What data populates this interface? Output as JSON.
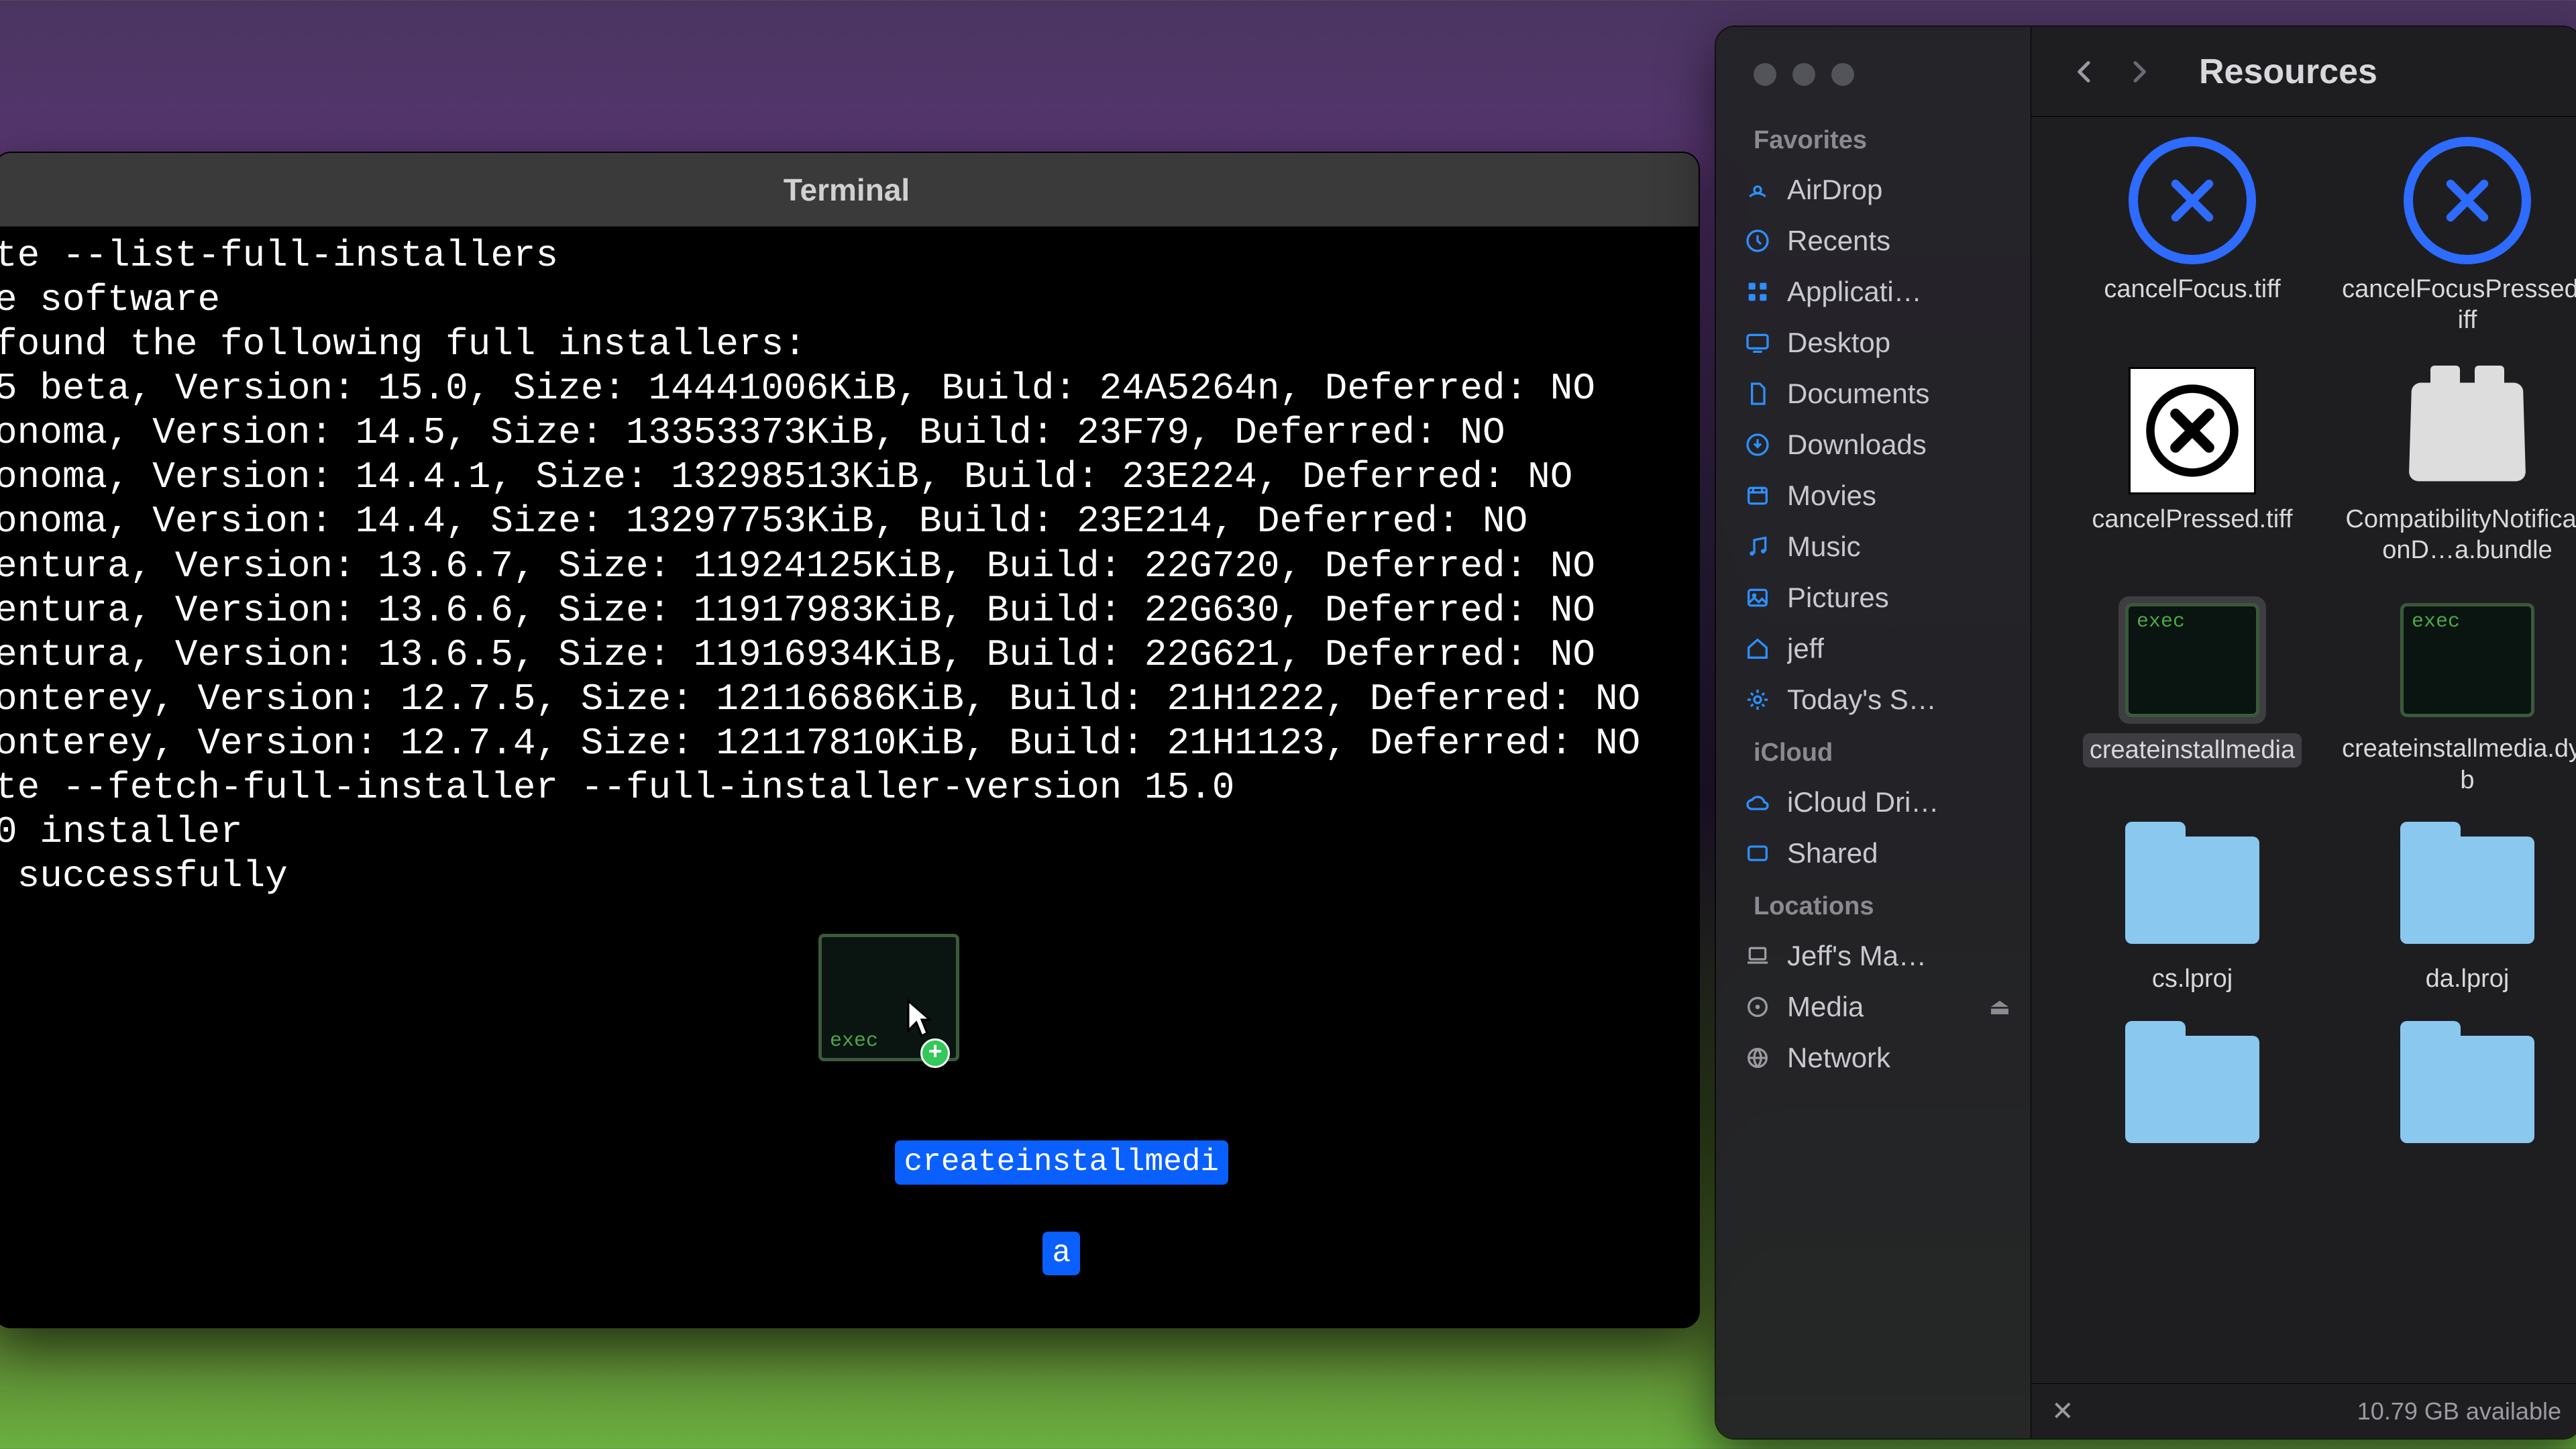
{
  "terminal": {
    "title": "Terminal",
    "lines": [
      "te --list-full-installers",
      "e software",
      "found the following full installers:",
      "5 beta, Version: 15.0, Size: 14441006KiB, Build: 24A5264n, Deferred: NO",
      "onoma, Version: 14.5, Size: 13353373KiB, Build: 23F79, Deferred: NO",
      "onoma, Version: 14.4.1, Size: 13298513KiB, Build: 23E224, Deferred: NO",
      "onoma, Version: 14.4, Size: 13297753KiB, Build: 23E214, Deferred: NO",
      "entura, Version: 13.6.7, Size: 11924125KiB, Build: 22G720, Deferred: NO",
      "entura, Version: 13.6.6, Size: 11917983KiB, Build: 22G630, Deferred: NO",
      "entura, Version: 13.6.5, Size: 11916934KiB, Build: 22G621, Deferred: NO",
      "onterey, Version: 12.7.5, Size: 12116686KiB, Build: 21H1222, Deferred: NO",
      "onterey, Version: 12.7.4, Size: 12117810KiB, Build: 21H1123, Deferred: NO",
      "te --fetch-full-installer --full-installer-version 15.0",
      "0 installer",
      " successfully"
    ],
    "drag": {
      "exec_tag": "exec",
      "filename_l1": "createinstallmedi",
      "filename_l2": "a"
    }
  },
  "finder": {
    "title": "Resources",
    "sidebar": {
      "favorites_label": "Favorites",
      "favorites": [
        {
          "icon": "airdrop-icon",
          "label": "AirDrop"
        },
        {
          "icon": "clock-icon",
          "label": "Recents"
        },
        {
          "icon": "apps-icon",
          "label": "Applicati…"
        },
        {
          "icon": "desktop-icon",
          "label": "Desktop"
        },
        {
          "icon": "doc-icon",
          "label": "Documents"
        },
        {
          "icon": "download-icon",
          "label": "Downloads"
        },
        {
          "icon": "movies-icon",
          "label": "Movies"
        },
        {
          "icon": "music-icon",
          "label": "Music"
        },
        {
          "icon": "pictures-icon",
          "label": "Pictures"
        },
        {
          "icon": "home-icon",
          "label": "jeff"
        },
        {
          "icon": "gear-icon",
          "label": "Today's S…"
        }
      ],
      "icloud_label": "iCloud",
      "icloud": [
        {
          "icon": "cloud-icon",
          "label": "iCloud Dri…"
        },
        {
          "icon": "shared-icon",
          "label": "Shared"
        }
      ],
      "locations_label": "Locations",
      "locations": [
        {
          "icon": "laptop-icon",
          "label": "Jeff's Ma…"
        },
        {
          "icon": "disk-icon",
          "label": "Media",
          "eject": true
        },
        {
          "icon": "globe-icon",
          "label": "Network"
        }
      ]
    },
    "files": [
      {
        "kind": "circle-x",
        "label": "cancelFocus.tiff",
        "selected": false
      },
      {
        "kind": "circle-x",
        "label": "cancelFocusPressed.tiff",
        "selected": false
      },
      {
        "kind": "bw-x",
        "label": "cancelPressed.tiff",
        "selected": false
      },
      {
        "kind": "lego",
        "label": "CompatibilityNotificationD…a.bundle",
        "selected": false
      },
      {
        "kind": "exec",
        "label": "createinstallmedia",
        "selected": true
      },
      {
        "kind": "exec",
        "label": "createinstallmedia.dylib",
        "selected": false
      },
      {
        "kind": "folder",
        "label": "cs.lproj",
        "selected": false
      },
      {
        "kind": "folder",
        "label": "da.lproj",
        "selected": false
      },
      {
        "kind": "folder",
        "label": "",
        "selected": false
      },
      {
        "kind": "folder",
        "label": "",
        "selected": false
      }
    ],
    "status": "10.79 GB available"
  }
}
